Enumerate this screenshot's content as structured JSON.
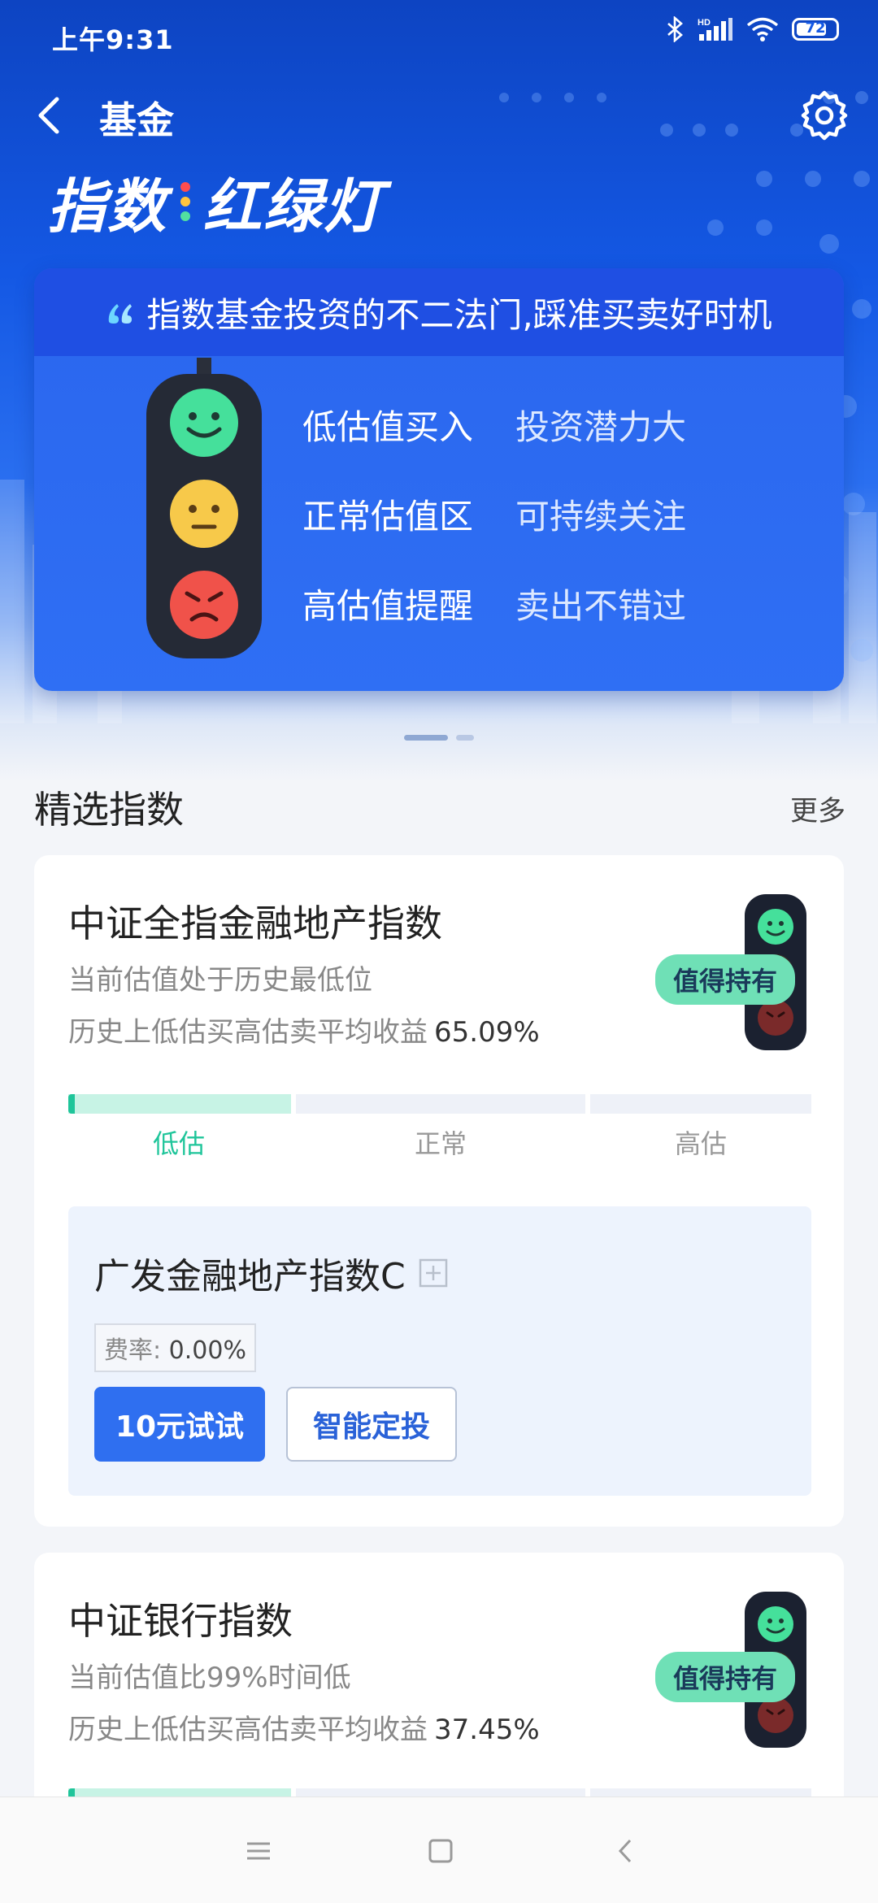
{
  "status_bar": {
    "time": "上午9:31",
    "battery": "72"
  },
  "nav": {
    "title": "基金"
  },
  "brand": {
    "left": "指数",
    "right": "红绿灯"
  },
  "banner": {
    "headline": "指数基金投资的不二法门,踩准买卖好时机",
    "rows": [
      {
        "label": "低估值买入",
        "note": "投资潜力大"
      },
      {
        "label": "正常估值区",
        "note": "可持续关注"
      },
      {
        "label": "高估值提醒",
        "note": "卖出不错过"
      }
    ]
  },
  "section": {
    "title": "精选指数",
    "more": "更多"
  },
  "cards": [
    {
      "name": "中证全指金融地产指数",
      "desc": "当前估值处于历史最低位",
      "return_label": "历史上低估买高估卖平均收益",
      "return_value": "65.09%",
      "badge": "值得持有",
      "scale": [
        "低估",
        "正常",
        "高估"
      ],
      "fund": {
        "name": "广发金融地产指数C",
        "fee_label": "费率:",
        "fee_value": "0.00%",
        "btn_try": "10元试试",
        "btn_plan": "智能定投"
      }
    },
    {
      "name": "中证银行指数",
      "desc": "当前估值比99%时间低",
      "return_label": "历史上低估买高估卖平均收益",
      "return_value": "37.45%",
      "badge": "值得持有"
    }
  ],
  "colors": {
    "primary": "#2f6ff0",
    "green": "#1fc59a",
    "hero": "#1458e4"
  }
}
